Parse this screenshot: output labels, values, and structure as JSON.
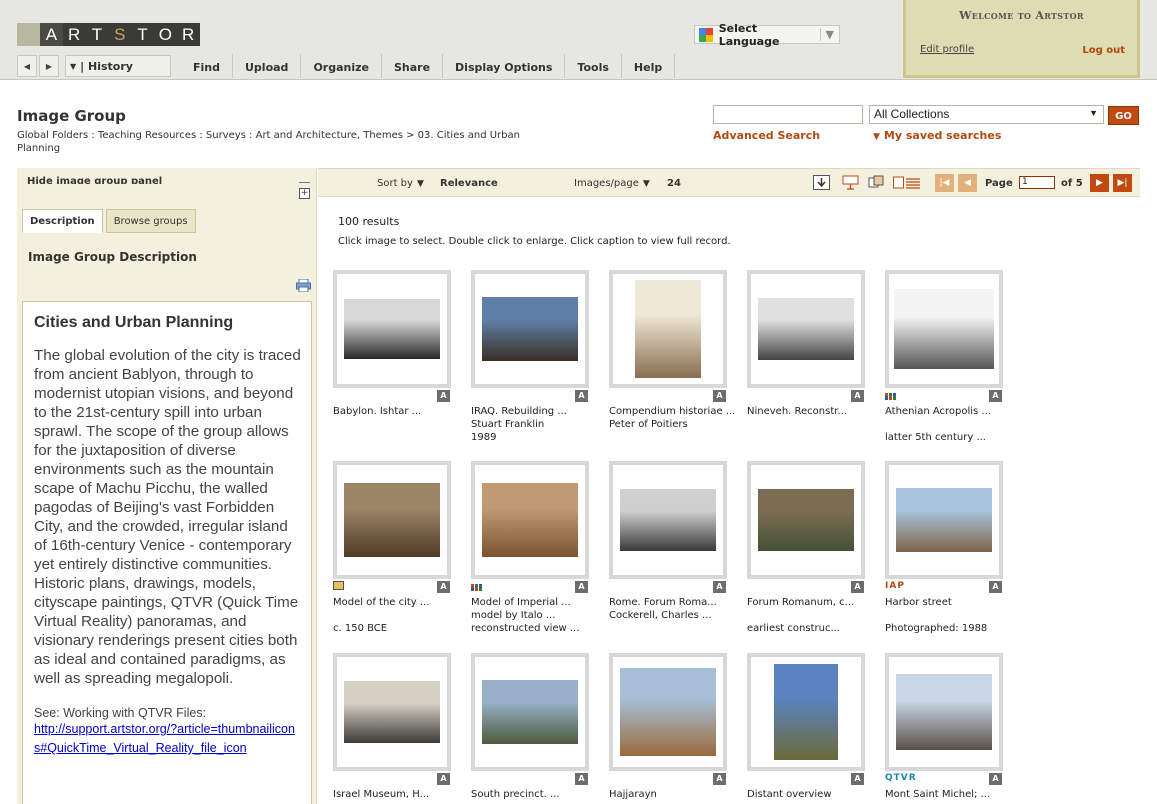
{
  "header": {
    "logo_letters": [
      "A",
      "R",
      "T",
      "S",
      "T",
      "O",
      "R"
    ],
    "language": "Select Language",
    "nav": {
      "history": "| History",
      "menu": [
        "Find",
        "Upload",
        "Organize",
        "Share",
        "Display Options",
        "Tools",
        "Help"
      ]
    },
    "welcome": {
      "title": "Welcome to Artstor",
      "edit_profile": "Edit profile",
      "logout": "Log out"
    }
  },
  "page": {
    "title": "Image Group",
    "breadcrumb": "Global Folders : Teaching Resources : Surveys : Art and Architecture, Themes > 03. Cities and Urban Planning"
  },
  "search": {
    "value": "",
    "collection": "All Collections",
    "go": "GO",
    "advanced": "Advanced Search",
    "saved": "My saved searches"
  },
  "panel": {
    "hide": "Hide image group panel",
    "tabs": [
      "Description",
      "Browse groups"
    ],
    "heading": "Image Group Description",
    "desc_title": "Cities and Urban Planning",
    "desc_text": "The global evolution of the city is traced from ancient Bablyon, through to modernist utopian visions, and beyond to the 21st-century spill into urban sprawl.  The scope of the group allows for the juxtaposition of diverse environments such as the mountain scape of Machu Picchu, the walled pagodas of Beijing's vast Forbidden City, and the crowded, irregular island of 16th-century Venice - contemporary yet entirely distinctive communities.  Historic plans, drawings, models, cityscape paintings, QTVR (Quick Time Virtual Reality) panoramas, and visionary renderings present cities both as ideal and contained paradigms, as well as spreading megalopoli.",
    "see": "See: Working with QTVR Files:",
    "link": "http://support.artstor.org/?article=thumbnailicons#QuickTime_Virtual_Reality_file_icon"
  },
  "toolbar": {
    "sort_label": "Sort by",
    "sort_value": "Relevance",
    "ipp_label": "Images/page",
    "ipp_value": "24",
    "page_label": "Page",
    "page_value": "1",
    "of_label": "of 5"
  },
  "results": {
    "count": "100 results",
    "hint": "Click image to select. Double click to enlarge. Click caption to view full record.",
    "badge": "A",
    "items": [
      {
        "lines": [
          "Babylon. Ishtar ..."
        ],
        "extra": "",
        "icon": "",
        "colors": [
          "#d8d8d8",
          "#2a2a2a"
        ]
      },
      {
        "lines": [
          "IRAQ. Rebuilding ...",
          "Stuart Franklin",
          "1989"
        ],
        "extra": "",
        "icon": "",
        "colors": [
          "#5f7fa8",
          "#3a3024"
        ]
      },
      {
        "lines": [
          "Compendium historiae ...",
          "Peter of Poitiers"
        ],
        "extra": "",
        "icon": "",
        "colors": [
          "#efe8d6",
          "#8a6e50"
        ]
      },
      {
        "lines": [
          "Nineveh. Reconstr..."
        ],
        "extra": "",
        "icon": "",
        "colors": [
          "#e0e0e0",
          "#444444"
        ]
      },
      {
        "lines": [
          "Athenian Acropolis ...",
          "",
          "latter 5th century ..."
        ],
        "extra": "",
        "icon": "dots-icon",
        "colors": [
          "#f4f4f4",
          "#555555"
        ]
      },
      {
        "lines": [
          "Model of the city ...",
          "",
          "c. 150 BCE"
        ],
        "extra": "",
        "icon": "slide-icon",
        "colors": [
          "#9c8466",
          "#4e3a26"
        ]
      },
      {
        "lines": [
          "Model of Imperial ...",
          "model by Italo ...",
          "reconstructed view ..."
        ],
        "extra": "",
        "icon": "dots-icon",
        "colors": [
          "#c09a72",
          "#7a5430"
        ]
      },
      {
        "lines": [
          "Rome. Forum Roma...",
          "Cockerell, Charles ..."
        ],
        "extra": "",
        "icon": "",
        "colors": [
          "#cfcfcf",
          "#3a3a3a"
        ]
      },
      {
        "lines": [
          "Forum Romanum, c...",
          "",
          "earliest construc..."
        ],
        "extra": "",
        "icon": "",
        "colors": [
          "#7b6c52",
          "#465234"
        ]
      },
      {
        "lines": [
          "Harbor street",
          "",
          "Photographed: 1988"
        ],
        "extra": "IAP",
        "icon": "",
        "colors": [
          "#a9c4dc",
          "#7c6446"
        ]
      },
      {
        "lines": [
          "Israel Museum, H..."
        ],
        "extra": "",
        "icon": "",
        "colors": [
          "#d6d0c4",
          "#3d3a36"
        ]
      },
      {
        "lines": [
          "South precinct. ..."
        ],
        "extra": "",
        "icon": "",
        "colors": [
          "#98b0c8",
          "#4d5a3a"
        ]
      },
      {
        "lines": [
          "Hajjarayn"
        ],
        "extra": "",
        "icon": "",
        "colors": [
          "#a7bfd6",
          "#9a6a3c"
        ]
      },
      {
        "lines": [
          "Distant overview"
        ],
        "extra": "",
        "icon": "",
        "colors": [
          "#5a83c0",
          "#6c6a3a"
        ]
      },
      {
        "lines": [
          "Mont Saint Michel; ..."
        ],
        "extra": "QTVR",
        "icon": "",
        "colors": [
          "#c8d6e6",
          "#5a5048"
        ]
      }
    ]
  }
}
